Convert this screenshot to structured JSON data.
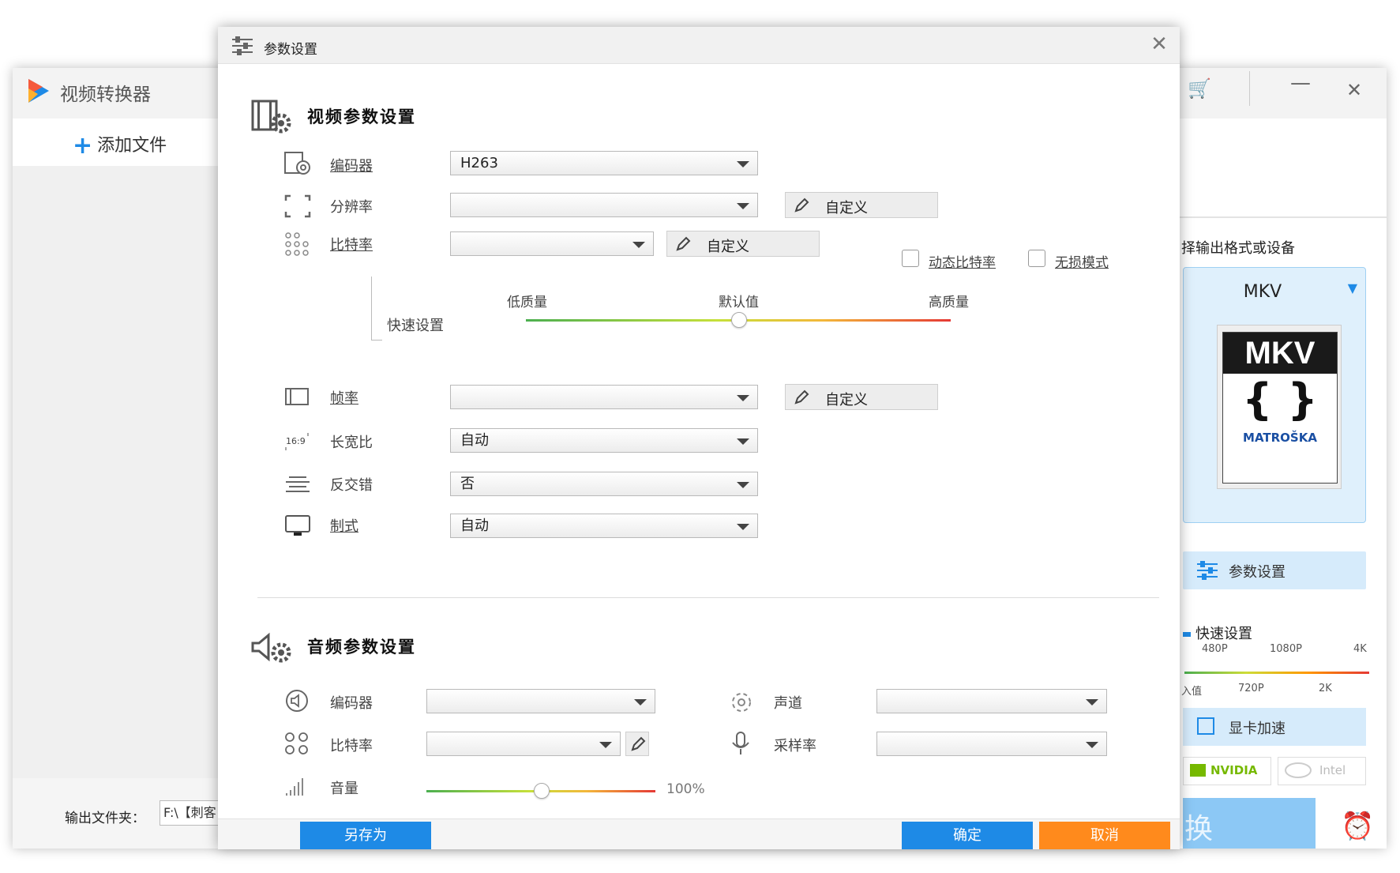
{
  "bg_app": {
    "title": "视频转换器",
    "add_file": "添加文件",
    "output_folder_label": "输出文件夹：",
    "output_folder_value": "F:\\【刺客",
    "output_format_label": "择输出格式或设备",
    "format_name": "MKV",
    "format_logo": {
      "head": "MKV",
      "brace": "{ }",
      "foot": "MATROŠKA"
    },
    "params_button": "参数设置",
    "quick_settings": "快速设置",
    "quality_ticks_top": [
      "480P",
      "1080P",
      "4K"
    ],
    "quality_ticks_bottom": [
      "入值",
      "720P",
      "2K"
    ],
    "gpu_accel": "显卡加速",
    "gpu_nvidia": "NVIDIA",
    "gpu_intel": "Intel",
    "convert_button": "换"
  },
  "dialog": {
    "title": "参数设置",
    "video": {
      "heading": "视频参数设置",
      "encoder": {
        "label": "编码器",
        "value": "H263"
      },
      "resolution": {
        "label": "分辨率",
        "value": "",
        "custom": "自定义"
      },
      "bitrate": {
        "label": "比特率",
        "value": "",
        "custom": "自定义",
        "dynamic_bitrate": "动态比特率",
        "lossless": "无损模式"
      },
      "quick": {
        "label": "快速设置",
        "low": "低质量",
        "default": "默认值",
        "high": "高质量",
        "level": 0.5
      },
      "framerate": {
        "label": "帧率",
        "value": "",
        "custom": "自定义"
      },
      "aspect": {
        "label": "长宽比",
        "value": "自动"
      },
      "deinterlace": {
        "label": "反交错",
        "value": "否"
      },
      "standard": {
        "label": "制式",
        "value": "自动"
      }
    },
    "audio": {
      "heading": "音频参数设置",
      "encoder": {
        "label": "编码器",
        "value": ""
      },
      "bitrate": {
        "label": "比特率",
        "value": ""
      },
      "volume": {
        "label": "音量",
        "value": "100%",
        "level": 0.5
      },
      "channel": {
        "label": "声道",
        "value": ""
      },
      "samplerate": {
        "label": "采样率",
        "value": ""
      }
    },
    "buttons": {
      "save_as": "另存为",
      "ok": "确定",
      "cancel": "取消"
    }
  },
  "colors": {
    "accent": "#1e8ae6",
    "cancel": "#ff8a1c"
  }
}
